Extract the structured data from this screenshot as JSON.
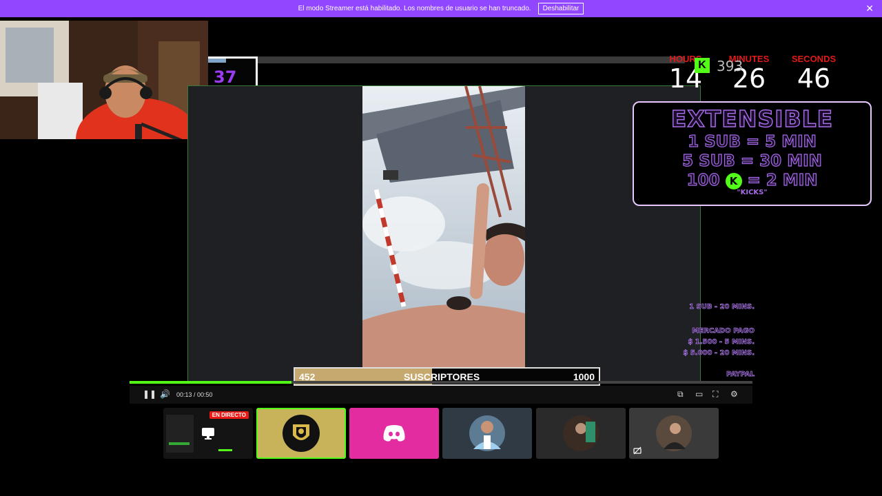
{
  "banner": {
    "message": "El modo Streamer está habilitado. Los nombres de usuario se han truncado.",
    "button_label": "Deshabilitar",
    "close_glyph": "✕"
  },
  "overlay": {
    "sub_box_count": "37",
    "timer": {
      "hours_label": "HOURS",
      "minutes_label": "MINUTES",
      "seconds_label": "SECONDS",
      "hours": "14",
      "minutes": "26",
      "seconds": "46"
    },
    "kick_badge": "K",
    "kick_count": "393",
    "extensible": {
      "title": "EXTENSIBLE",
      "line1": "1 SUB = 5 MIN",
      "line2": "5 SUB = 30 MIN",
      "line3_pre": "100",
      "line3_post": "= 2 MIN",
      "kick_glyph": "K",
      "note": "\"KICKS\""
    },
    "promo": {
      "sub_rate": "1 SUB - 20 MINS.",
      "mercado_title": "MERCADO PAGO",
      "mercado_1": "$ 1.500 - 5 MINS.",
      "mercado_2": "$ 5.000 - 20 MINS.",
      "paypal_title": "PAYPAL"
    },
    "subs_bar": {
      "current": "452",
      "label": "SUSCRIPTORES",
      "goal": "1000",
      "fill_fraction": 0.452
    }
  },
  "player": {
    "time_display": "00:13 / 00:50",
    "progress_fraction": 0.26,
    "pause_icon": "❚❚",
    "volume_icon": "🔊",
    "pip_icon": "⧉",
    "theater_icon": "▭",
    "fullscreen_icon": "⛶",
    "settings_icon": "⚙"
  },
  "thumbnails": [
    {
      "name": "screen-share",
      "badge": "EN DIRECTO",
      "icon": "monitor-icon",
      "bg": "#141414"
    },
    {
      "name": "team-logo",
      "icon": "shield-logo-icon",
      "bg": "#c9b35a"
    },
    {
      "name": "discord",
      "icon": "discord-icon",
      "bg": "#e22ca0"
    },
    {
      "name": "player-photo",
      "icon": "avatar",
      "bg": "#2f3a44"
    },
    {
      "name": "room-photo",
      "icon": "avatar",
      "bg": "#2a2a2a"
    },
    {
      "name": "person-photo",
      "icon": "avatar",
      "bg": "#3a3a3a"
    }
  ],
  "colors": {
    "banner": "#9146ff",
    "kick_green": "#53fc18",
    "timer_label_red": "#e01a1a",
    "overlay_purple": "#a66be8"
  }
}
